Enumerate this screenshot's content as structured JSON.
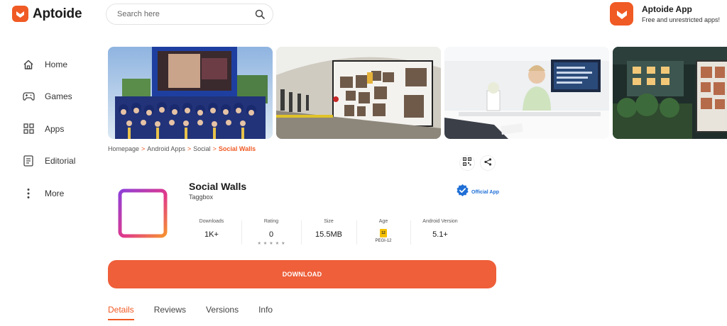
{
  "header": {
    "logo_text": "Aptoide",
    "search_placeholder": "Search here",
    "promo_title": "Aptoide App",
    "promo_subtitle": "Free and unrestricted apps!"
  },
  "sidebar": {
    "items": [
      {
        "label": "Home",
        "icon": "home-icon"
      },
      {
        "label": "Games",
        "icon": "gamepad-icon"
      },
      {
        "label": "Apps",
        "icon": "grid-icon"
      },
      {
        "label": "Editorial",
        "icon": "document-icon"
      },
      {
        "label": "More",
        "icon": "more-vertical-icon"
      }
    ]
  },
  "breadcrumb": {
    "items": [
      "Homepage",
      "Android Apps",
      "Social"
    ],
    "current": "Social Walls",
    "separator": ">"
  },
  "app": {
    "name": "Social Walls",
    "developer": "Taggbox",
    "official_label": "Official App"
  },
  "stats": {
    "downloads_label": "Downloads",
    "downloads_value": "1K+",
    "rating_label": "Rating",
    "rating_value": "0",
    "stars": [
      "★",
      "★",
      "★",
      "★",
      "★"
    ],
    "size_label": "Size",
    "size_value": "15.5MB",
    "age_label": "Age",
    "age_badge": "12",
    "age_value": "PEGI-12",
    "version_label": "Android Version",
    "version_value": "5.1+"
  },
  "download_label": "DOWNLOAD",
  "tabs": [
    "Details",
    "Reviews",
    "Versions",
    "Info"
  ],
  "colors": {
    "brand": "#f05a24",
    "download": "#ee5f3a",
    "official": "#1f6fd6"
  }
}
